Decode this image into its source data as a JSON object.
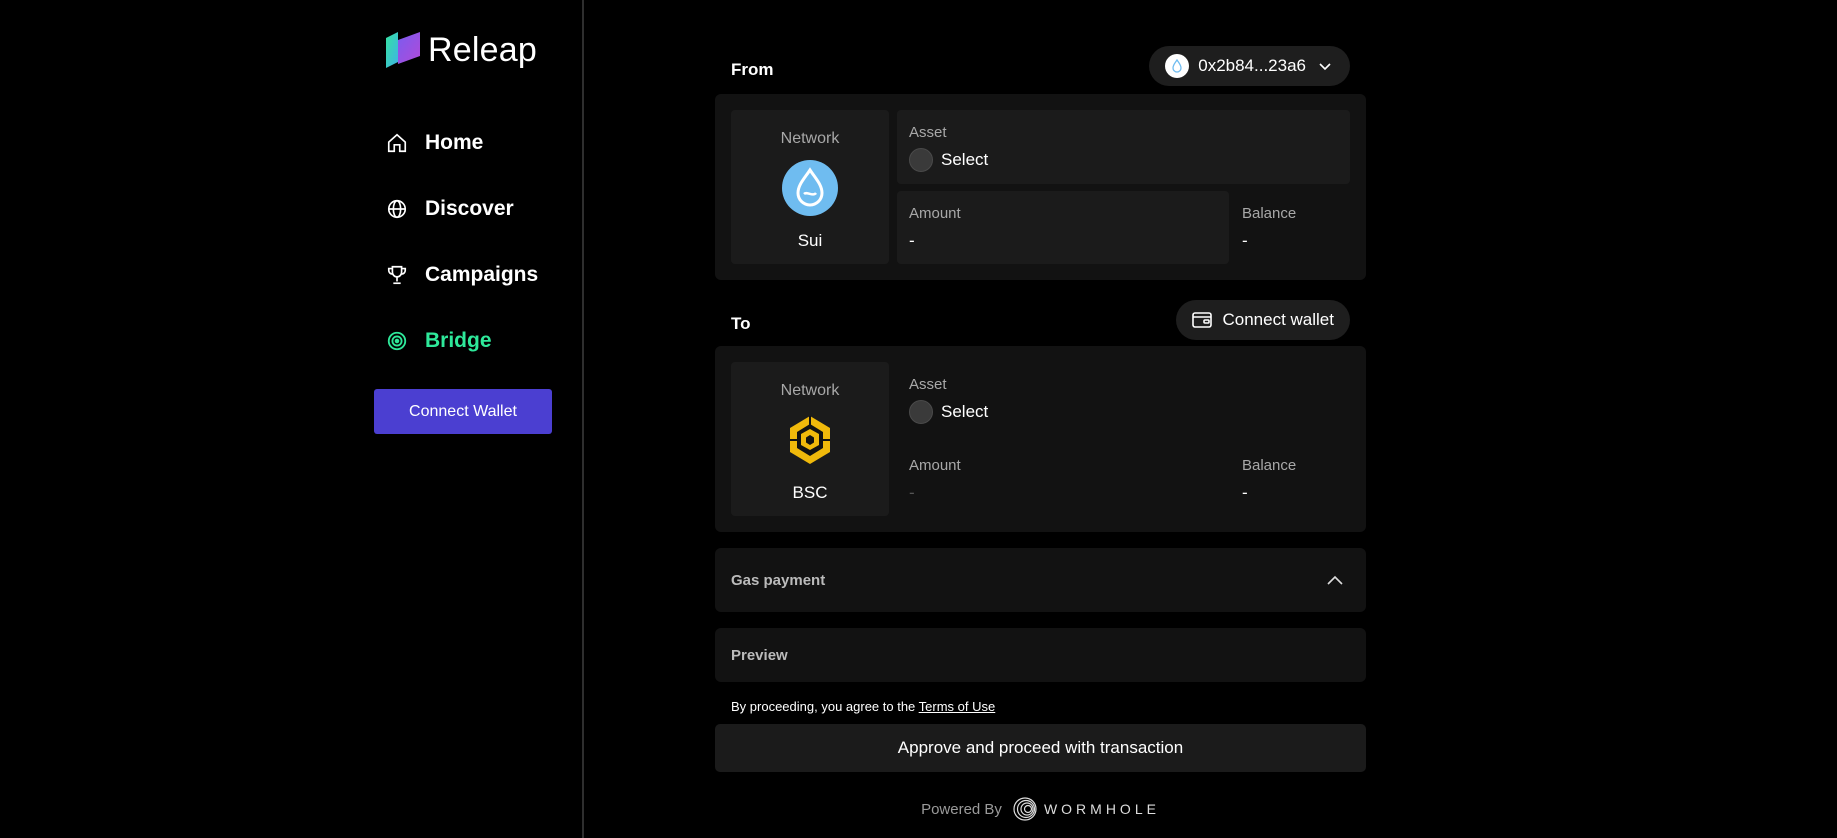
{
  "brand": {
    "name": "Releap"
  },
  "nav": {
    "items": [
      {
        "label": "Home",
        "icon": "home-icon"
      },
      {
        "label": "Discover",
        "icon": "globe-icon"
      },
      {
        "label": "Campaigns",
        "icon": "trophy-icon"
      },
      {
        "label": "Bridge",
        "icon": "target-icon",
        "active": true
      }
    ],
    "connect_label": "Connect Wallet"
  },
  "colors": {
    "accent": "#2ee89a",
    "button": "#4b3fd1",
    "bsc": "#f0b90b",
    "sui": "#6fbcf0"
  },
  "from": {
    "title": "From",
    "wallet_address": "0x2b84...23a6",
    "network_label": "Network",
    "network_name": "Sui",
    "asset_label": "Asset",
    "asset_value": "Select",
    "amount_label": "Amount",
    "amount_value": "-",
    "balance_label": "Balance",
    "balance_value": "-"
  },
  "to": {
    "title": "To",
    "connect_label": "Connect wallet",
    "network_label": "Network",
    "network_name": "BSC",
    "asset_label": "Asset",
    "asset_value": "Select",
    "amount_label": "Amount",
    "amount_value": "-",
    "balance_label": "Balance",
    "balance_value": "-"
  },
  "gas": {
    "label": "Gas payment"
  },
  "preview": {
    "label": "Preview"
  },
  "terms": {
    "prefix": "By proceeding, you agree to the ",
    "link": "Terms of Use"
  },
  "approve_label": "Approve and proceed with transaction",
  "powered": {
    "prefix": "Powered By",
    "brand": "WORMHOLE"
  }
}
